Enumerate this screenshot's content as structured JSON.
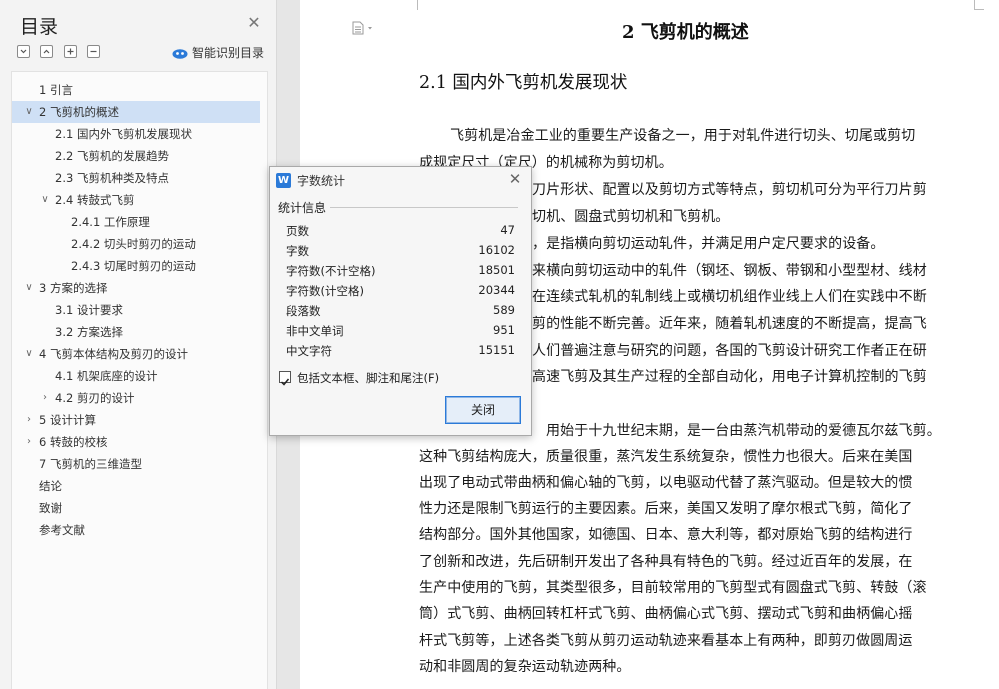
{
  "toc": {
    "title": "目录",
    "smart_label": "智能识别目录",
    "items": [
      {
        "label": "1 引言"
      },
      {
        "label": "2 飞剪机的概述"
      },
      {
        "label": "2.1 国内外飞剪机发展现状"
      },
      {
        "label": "2.2 飞剪机的发展趋势"
      },
      {
        "label": "2.3 飞剪机种类及特点"
      },
      {
        "label": "2.4 转鼓式飞剪"
      },
      {
        "label": "2.4.1 工作原理"
      },
      {
        "label": "2.4.2 切头时剪刃的运动"
      },
      {
        "label": "2.4.3 切尾时剪刃的运动"
      },
      {
        "label": "3 方案的选择"
      },
      {
        "label": "3.1 设计要求"
      },
      {
        "label": "3.2 方案选择"
      },
      {
        "label": "4 飞剪本体结构及剪刃的设计"
      },
      {
        "label": "4.1 机架底座的设计"
      },
      {
        "label": "4.2 剪刃的设计"
      },
      {
        "label": "5 设计计算"
      },
      {
        "label": "6 转鼓的校核"
      },
      {
        "label": "7 飞剪机的三维造型"
      },
      {
        "label": "结论"
      },
      {
        "label": "致谢"
      },
      {
        "label": "参考文献"
      }
    ]
  },
  "document": {
    "chapter_title": "2 飞剪机的概述",
    "section_title": "2.1 国内外飞剪机发展现状",
    "lines": [
      "飞剪机是冶金工业的重要生产设备之一，用于对轧件进行切头、切尾或剪切",
      "成规定尺寸（定尺）的机械称为剪切机。",
      "刀片形状、配置以及剪切方式等特点，剪切机可分为平行刀片剪",
      "切机、圆盘式剪切机和飞剪机。",
      "，是指横向剪切运动轧件，并满足用户定尺要求的设备。",
      "来横向剪切运动中的轧件（钢坯、钢板、带钢和小型型材、线材",
      "在连续式轧机的轧制线上或横切机组作业线上人们在实践中不断",
      "剪的性能不断完善。近年来，随着轧机速度的不断提高，提高飞",
      "人们普遍注意与研究的问题，各国的飞剪设计研究工作者正在研",
      "高速飞剪及其生产过程的全部自动化，用电子计算机控制的飞剪",
      "用始于十九世纪末期，是一台由蒸汽机带动的爱德瓦尔兹飞剪。",
      "这种飞剪结构庞大，质量很重，蒸汽发生系统复杂，惯性力也很大。后来在美国",
      "出现了电动式带曲柄和偏心轴的飞剪，以电驱动代替了蒸汽驱动。但是较大的惯",
      "性力还是限制飞剪运行的主要因素。后来，美国又发明了摩尔根式飞剪，简化了",
      "结构部分。国外其他国家，如德国、日本、意大利等，都对原始飞剪的结构进行",
      "了创新和改进，先后研制开发出了各种具有特色的飞剪。经过近百年的发展，在",
      "生产中使用的飞剪，其类型很多，目前较常用的飞剪型式有圆盘式飞剪、转鼓（滚",
      "筒）式飞剪、曲柄回转杠杆式飞剪、曲柄偏心式飞剪、摆动式飞剪和曲柄偏心摇",
      "杆式飞剪等，上述各类飞剪从剪刃运动轨迹来看基本上有两种，即剪刃做圆周运",
      "动和非圆周的复杂运动轨迹两种。"
    ]
  },
  "dialog": {
    "title": "字数统计",
    "group_label": "统计信息",
    "stats": [
      {
        "label": "页数",
        "value": "47"
      },
      {
        "label": "字数",
        "value": "16102"
      },
      {
        "label": "字符数(不计空格)",
        "value": "18501"
      },
      {
        "label": "字符数(计空格)",
        "value": "20344"
      },
      {
        "label": "段落数",
        "value": "589"
      },
      {
        "label": "非中文单词",
        "value": "951"
      },
      {
        "label": "中文字符",
        "value": "15151"
      }
    ],
    "checkbox_label": "包括文本框、脚注和尾注(F)",
    "checkbox_checked": true,
    "close_button": "关闭"
  }
}
